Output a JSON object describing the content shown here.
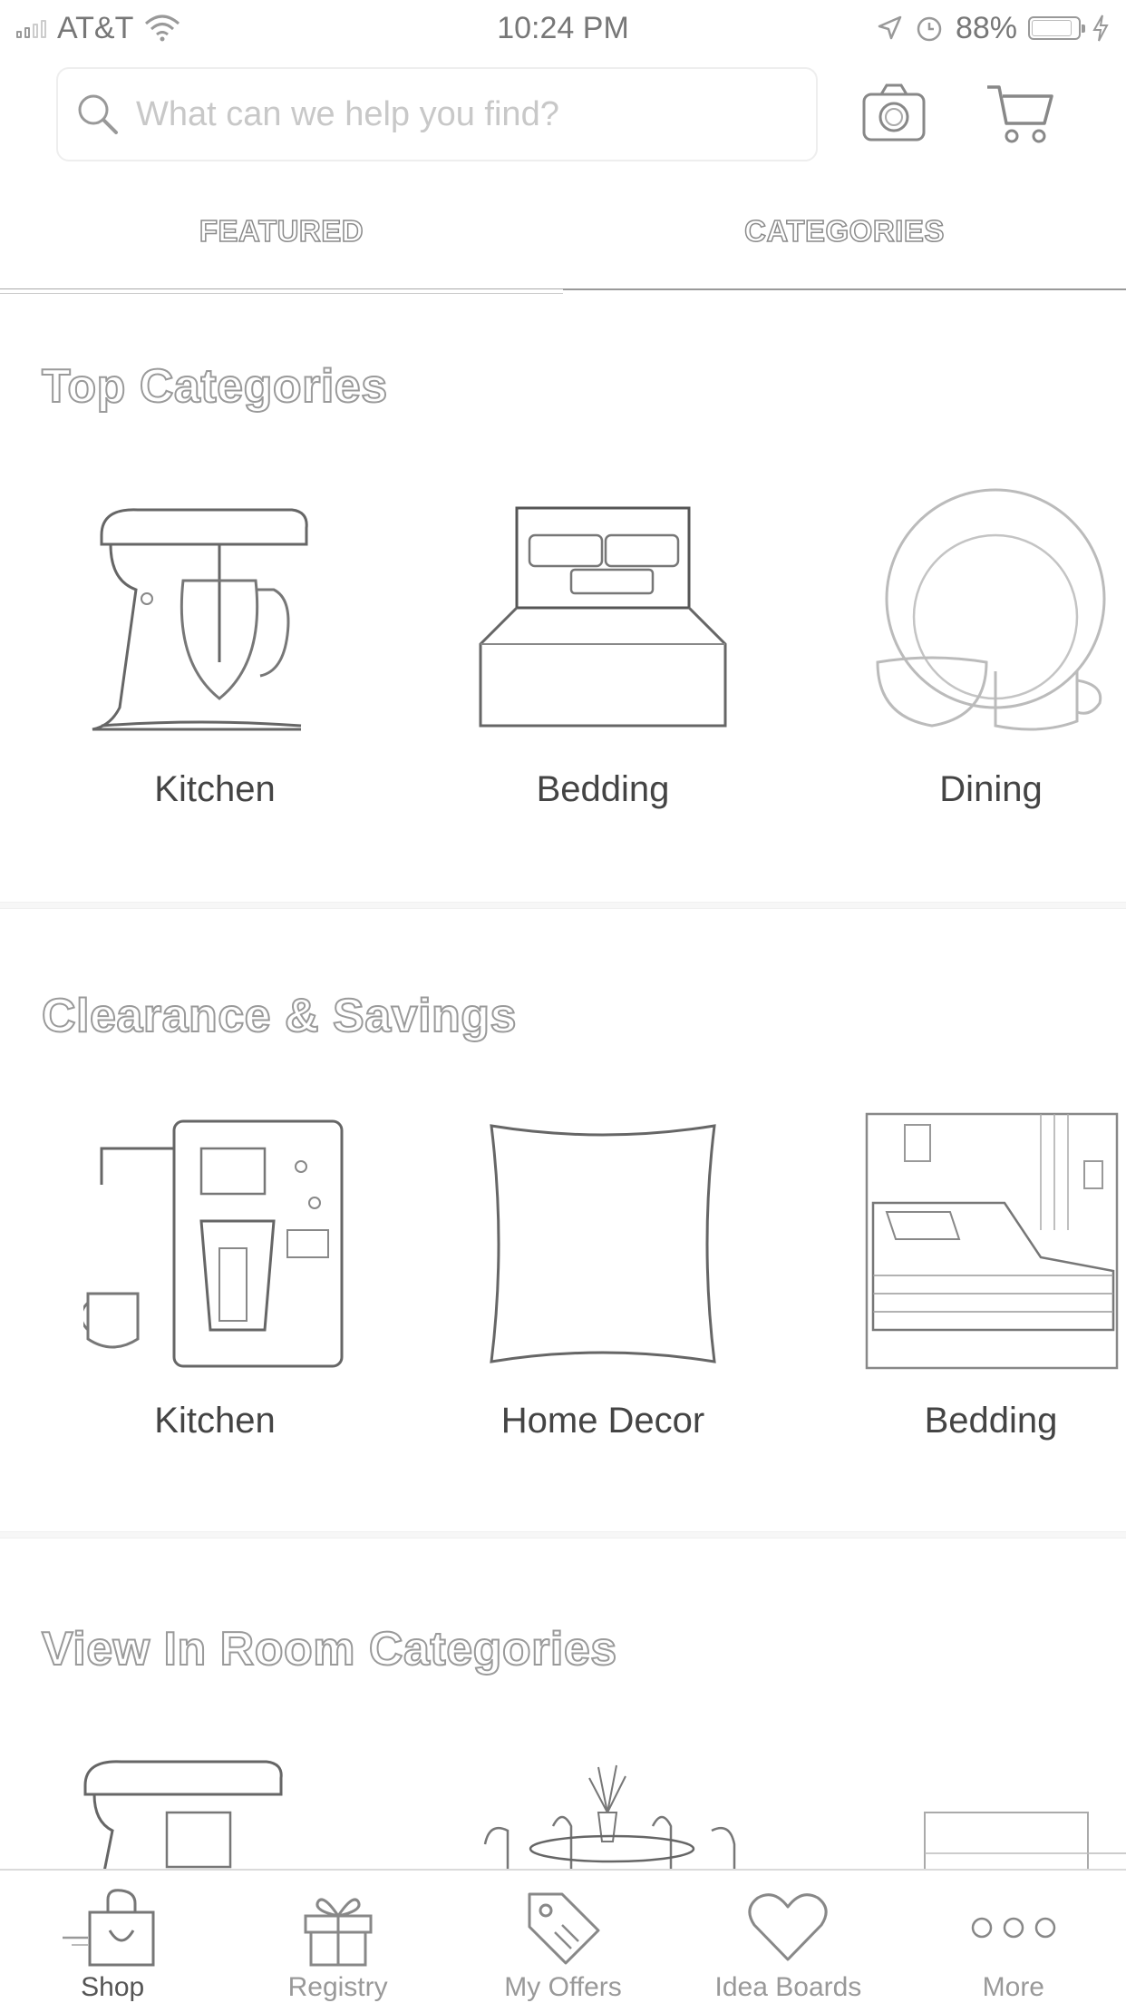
{
  "status_bar": {
    "carrier": "AT&T",
    "time": "10:24 PM",
    "battery": "88%",
    "battery_level": 0.88
  },
  "search": {
    "placeholder": "What can we help you find?"
  },
  "tabs": [
    {
      "label": "FEATURED",
      "active": true
    },
    {
      "label": "CATEGORIES",
      "active": false
    }
  ],
  "sections": {
    "top_categories": {
      "title": "Top Categories",
      "items": [
        {
          "label": "Kitchen",
          "icon": "stand-mixer-image"
        },
        {
          "label": "Bedding",
          "icon": "bed-image"
        },
        {
          "label": "Dining",
          "icon": "dinnerware-image"
        }
      ]
    },
    "clearance": {
      "title": "Clearance & Savings",
      "items": [
        {
          "label": "Kitchen",
          "icon": "coffee-maker-image"
        },
        {
          "label": "Home Decor",
          "icon": "pillow-image"
        },
        {
          "label": "Bedding",
          "icon": "bedroom-image"
        }
      ]
    },
    "view_in_room": {
      "title": "View In Room Categories"
    }
  },
  "bottom_nav": [
    {
      "label": "Shop",
      "icon": "shopping-bag-icon",
      "active": true
    },
    {
      "label": "Registry",
      "icon": "gift-icon",
      "active": false
    },
    {
      "label": "My Offers",
      "icon": "tag-icon",
      "active": false
    },
    {
      "label": "Idea Boards",
      "icon": "heart-icon",
      "active": false
    },
    {
      "label": "More",
      "icon": "more-dots-icon",
      "active": false
    }
  ]
}
